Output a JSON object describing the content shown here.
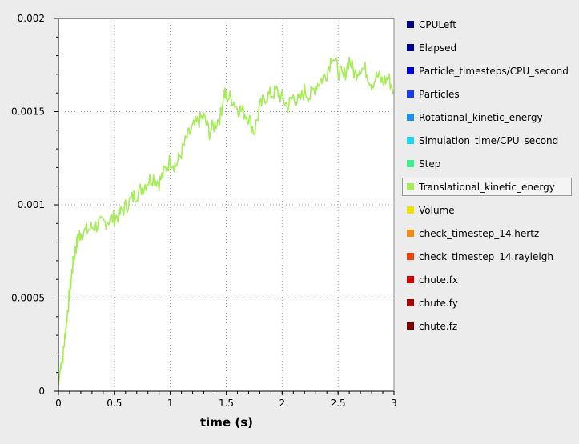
{
  "chart_data": {
    "type": "line",
    "title": "",
    "xlabel": "time (s)",
    "ylabel": "",
    "xlim": [
      0,
      3
    ],
    "ylim": [
      0,
      0.002
    ],
    "grid": true,
    "legend_placement": "right",
    "x_ticks": [
      {
        "value": 0,
        "label": "0"
      },
      {
        "value": 0.5,
        "label": "0.5"
      },
      {
        "value": 1,
        "label": "1"
      },
      {
        "value": 1.5,
        "label": "1.5"
      },
      {
        "value": 2,
        "label": "2"
      },
      {
        "value": 2.5,
        "label": "2.5"
      },
      {
        "value": 3,
        "label": "3"
      }
    ],
    "y_ticks": [
      {
        "value": 0,
        "label": "0"
      },
      {
        "value": 0.0005,
        "label": "0.0005"
      },
      {
        "value": 0.001,
        "label": "0.001"
      },
      {
        "value": 0.0015,
        "label": "0.0015"
      },
      {
        "value": 0.002,
        "label": "0.002"
      }
    ],
    "series": [
      {
        "name": "Translational_kinetic_energy",
        "color": "#a6ec5a",
        "x": [
          0,
          0.02,
          0.04,
          0.06,
          0.08,
          0.1,
          0.12,
          0.14,
          0.16,
          0.18,
          0.2,
          0.25,
          0.3,
          0.35,
          0.4,
          0.45,
          0.5,
          0.55,
          0.6,
          0.65,
          0.7,
          0.75,
          0.8,
          0.85,
          0.9,
          0.95,
          1.0,
          1.05,
          1.1,
          1.15,
          1.2,
          1.25,
          1.3,
          1.35,
          1.4,
          1.45,
          1.48,
          1.5,
          1.55,
          1.6,
          1.65,
          1.7,
          1.75,
          1.8,
          1.85,
          1.9,
          1.95,
          2.0,
          2.05,
          2.1,
          2.15,
          2.2,
          2.25,
          2.3,
          2.35,
          2.4,
          2.45,
          2.5,
          2.55,
          2.6,
          2.65,
          2.7,
          2.75,
          2.8,
          2.85,
          2.9,
          2.95,
          3.0
        ],
        "y": [
          3e-05,
          0.00014,
          0.00019,
          0.0003,
          0.00042,
          0.00052,
          0.00064,
          0.00072,
          0.00078,
          0.00083,
          0.00085,
          0.00086,
          0.00088,
          0.00089,
          0.0009,
          0.00092,
          0.00093,
          0.00095,
          0.00099,
          0.00103,
          0.00106,
          0.00109,
          0.00113,
          0.00115,
          0.00112,
          0.00118,
          0.00124,
          0.00121,
          0.00128,
          0.00136,
          0.00141,
          0.00145,
          0.00147,
          0.00139,
          0.00143,
          0.00148,
          0.0016,
          0.00158,
          0.00157,
          0.00152,
          0.0015,
          0.00147,
          0.00139,
          0.00152,
          0.00158,
          0.00159,
          0.00161,
          0.00157,
          0.00153,
          0.00158,
          0.00155,
          0.00161,
          0.00158,
          0.00164,
          0.00167,
          0.00171,
          0.00181,
          0.00172,
          0.00168,
          0.00178,
          0.0017,
          0.00174,
          0.00172,
          0.00165,
          0.00169,
          0.00166,
          0.00168,
          0.00161
        ]
      }
    ]
  },
  "legend": {
    "active_index": 7,
    "items": [
      {
        "label": "CPULeft",
        "color": "#000080"
      },
      {
        "label": "Elapsed",
        "color": "#000099"
      },
      {
        "label": "Particle_timesteps/CPU_second",
        "color": "#0000dd"
      },
      {
        "label": "Particles",
        "color": "#1a3cf0"
      },
      {
        "label": "Rotational_kinetic_energy",
        "color": "#1e8cf0"
      },
      {
        "label": "Simulation_time/CPU_second",
        "color": "#22d8f0"
      },
      {
        "label": "Step",
        "color": "#3cf08c"
      },
      {
        "label": "Translational_kinetic_energy",
        "color": "#a6ec5a"
      },
      {
        "label": "Volume",
        "color": "#f0e000"
      },
      {
        "label": "check_timestep_14.hertz",
        "color": "#f08c10"
      },
      {
        "label": "check_timestep_14.rayleigh",
        "color": "#f04010"
      },
      {
        "label": "chute.fx",
        "color": "#d40000"
      },
      {
        "label": "chute.fy",
        "color": "#a80000"
      },
      {
        "label": "chute.fz",
        "color": "#800000"
      }
    ]
  }
}
